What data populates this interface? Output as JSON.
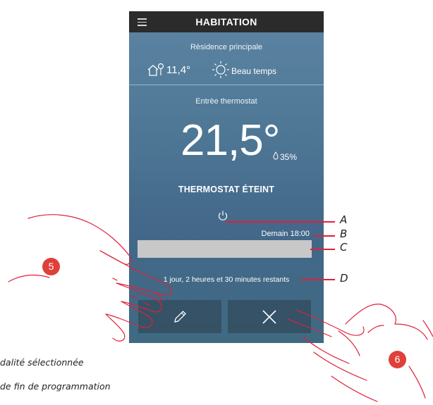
{
  "header": {
    "title": "HABITATION",
    "menu_icon": "hamburger-menu-icon"
  },
  "location": {
    "name": "Rèsidence principale"
  },
  "weather": {
    "outdoor_temp": "11,4°",
    "condition": "Beau temps",
    "icons": [
      "house-thermometer-icon",
      "sun-icon"
    ]
  },
  "thermostat": {
    "name": "Entrèe thermostat",
    "temperature": "21,5°",
    "humidity": "35%",
    "status": "THERMOSTAT ÉTEINT",
    "end_time": "Demain 18:00",
    "remaining": "1 jour, 2 heures et 30 minutes restants",
    "progress_fraction": 0.0
  },
  "actions": {
    "edit_icon": "pencil-icon",
    "cancel_icon": "close-icon"
  },
  "callouts": {
    "a": "A",
    "b": "B",
    "c": "C",
    "d": "D"
  },
  "badges": {
    "left": "5",
    "right": "6"
  },
  "captions": {
    "line1": "dalité sélectionnée",
    "line2": "de fin de programmation"
  },
  "colors": {
    "accent_red": "#e0203a",
    "badge_red": "#e0403a",
    "topbar": "#2b2b2b"
  }
}
